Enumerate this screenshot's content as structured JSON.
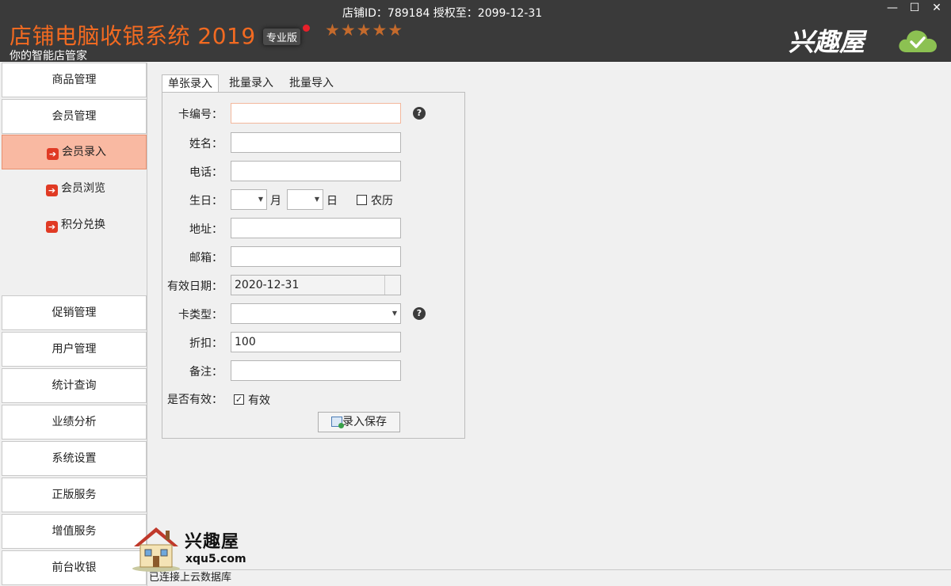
{
  "window": {
    "title": "店铺电脑收银系统 2019",
    "edition": "专业版",
    "stars": "★★★★★",
    "subtitle": "你的智能店管家",
    "store_info": "店铺ID：789184 授权至：2099-12-31",
    "brand": "兴趣屋",
    "controls": {
      "minimize": "—",
      "maximize": "☐",
      "close": "✕"
    }
  },
  "sidebar": {
    "groups_top": [
      {
        "label": "商品管理"
      },
      {
        "label": "会员管理"
      }
    ],
    "sub_items": [
      {
        "label": "会员录入",
        "active": true
      },
      {
        "label": "会员浏览",
        "active": false
      },
      {
        "label": "积分兑换",
        "active": false
      }
    ],
    "groups_bottom": [
      {
        "label": "促销管理"
      },
      {
        "label": "用户管理"
      },
      {
        "label": "统计查询"
      },
      {
        "label": "业绩分析"
      },
      {
        "label": "系统设置"
      },
      {
        "label": "正版服务"
      },
      {
        "label": "增值服务"
      },
      {
        "label": "前台收银"
      }
    ],
    "arrow_glyph": "➔"
  },
  "tabs": [
    {
      "label": "单张录入",
      "active": true
    },
    {
      "label": "批量录入",
      "active": false
    },
    {
      "label": "批量导入",
      "active": false
    }
  ],
  "form": {
    "card_no": {
      "label": "卡编号：",
      "value": ""
    },
    "name": {
      "label": "姓名：",
      "value": ""
    },
    "phone": {
      "label": "电话：",
      "value": ""
    },
    "birthday": {
      "label": "生日：",
      "month_unit": "月",
      "day_unit": "日",
      "lunar_label": "农历",
      "lunar_checked": false
    },
    "address": {
      "label": "地址：",
      "value": ""
    },
    "email": {
      "label": "邮箱：",
      "value": ""
    },
    "valid_date": {
      "label": "有效日期：",
      "value": "2020-12-31"
    },
    "card_type": {
      "label": "卡类型：",
      "value": ""
    },
    "discount": {
      "label": "折扣：",
      "value": "100"
    },
    "remark": {
      "label": "备注：",
      "value": ""
    },
    "is_valid": {
      "label": "是否有效：",
      "checkbox_label": "有效",
      "checked": true
    },
    "help_glyph": "?",
    "save_button": "录入保存"
  },
  "statusbar": {
    "text": "已连接上云数据库"
  },
  "watermark": {
    "name": "兴趣屋",
    "url": "xqu5.com"
  },
  "colors": {
    "accent": "#f26a21",
    "titlebar": "#3a3a3a",
    "active_item": "#f9b9a2",
    "arrow_icon": "#e03a24",
    "cloud": "#8cc152"
  },
  "icons": {
    "cloud": "cloud-check-icon",
    "help": "question-icon",
    "arrow": "arrow-right-icon",
    "save": "save-icon",
    "house": "house-icon"
  }
}
